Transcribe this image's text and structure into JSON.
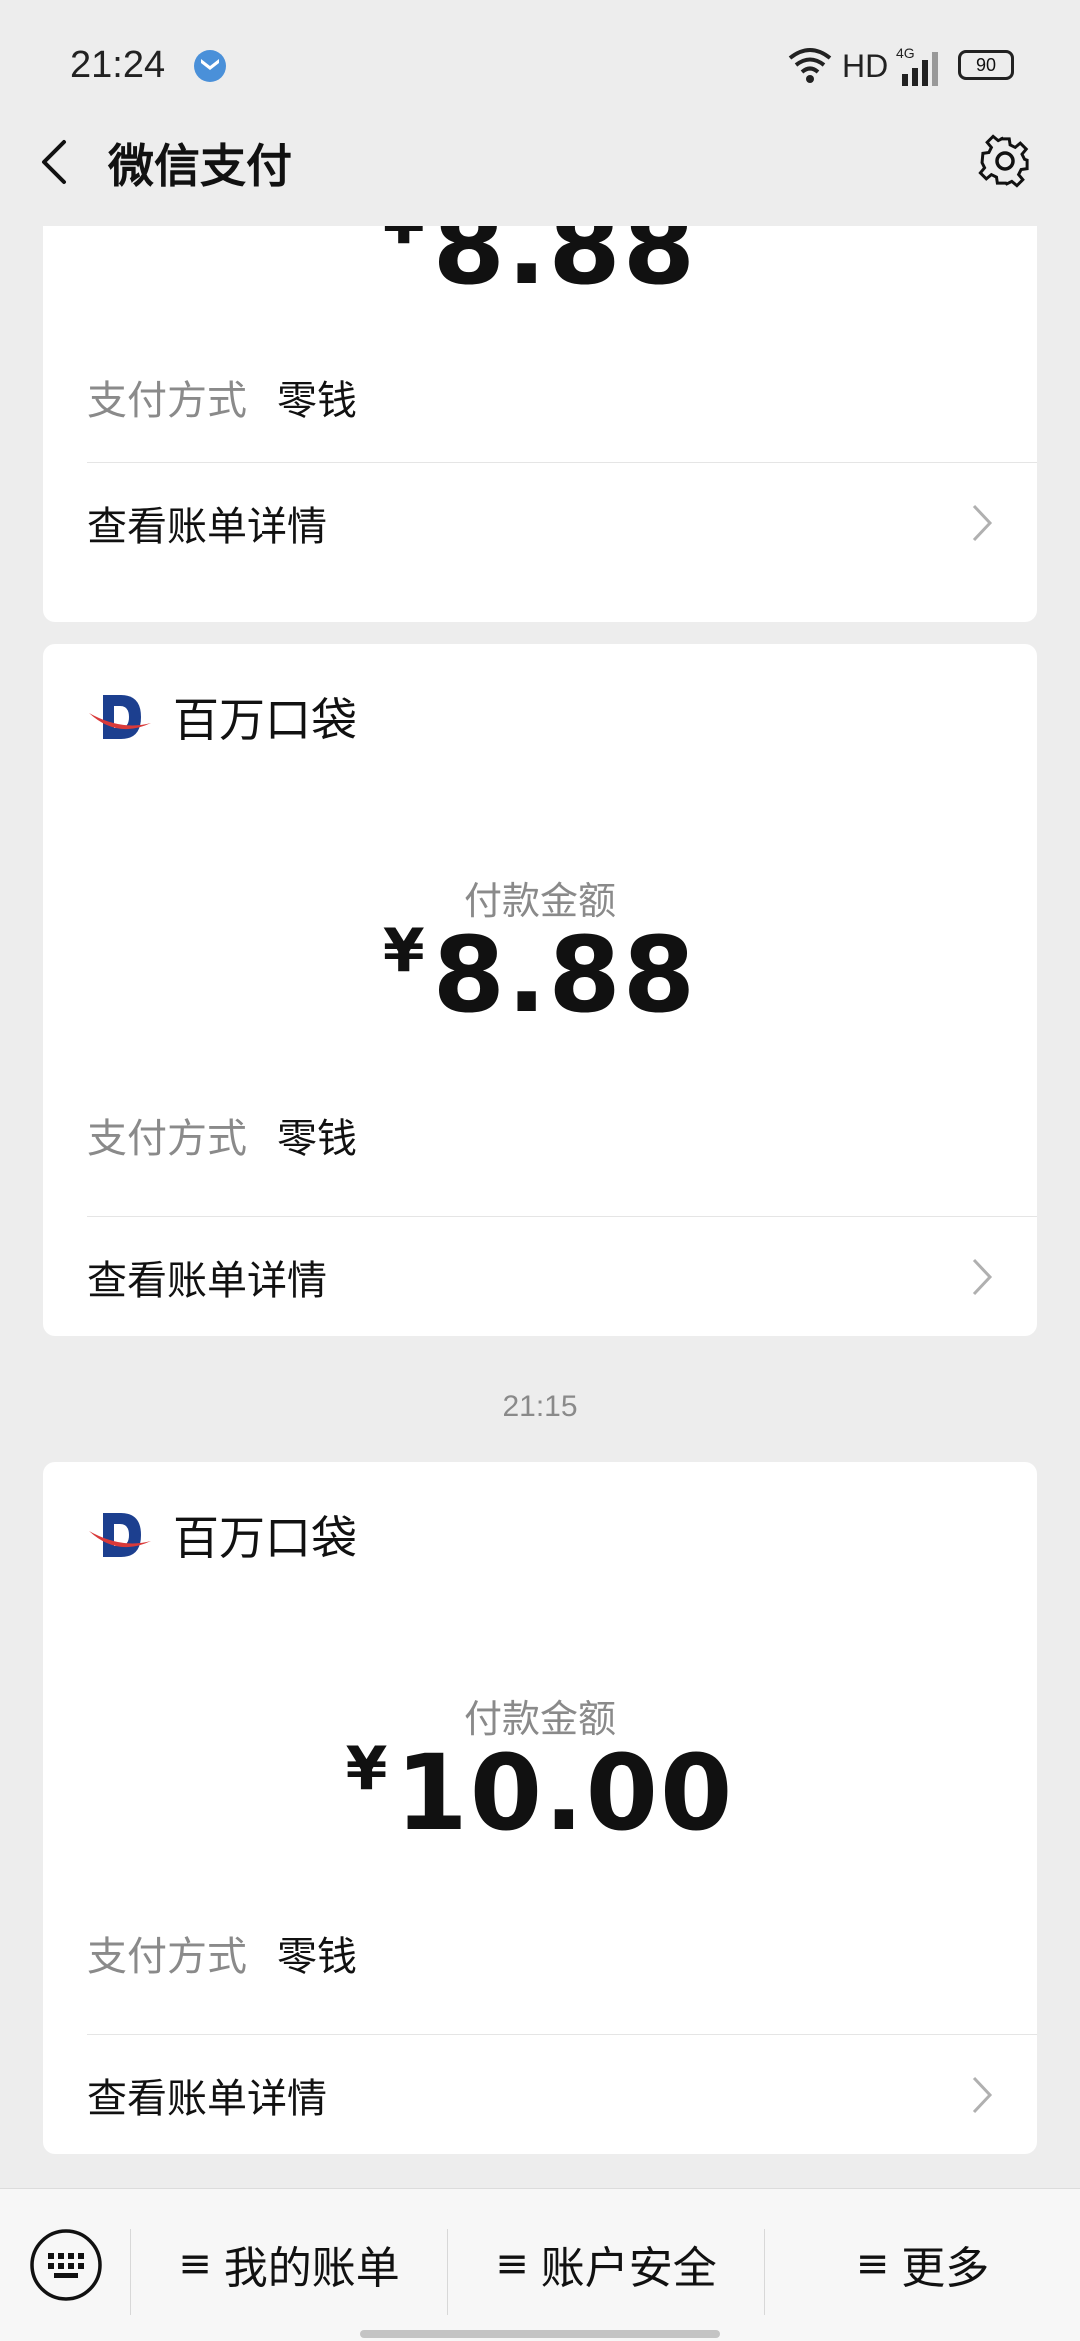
{
  "status_bar": {
    "time": "21:24",
    "network": "HD",
    "signal_label": "4G",
    "battery": "90"
  },
  "nav": {
    "title": "微信支付"
  },
  "cards": [
    {
      "merchant": "",
      "amount_label": "",
      "currency": "¥",
      "amount": "8.88",
      "pay_method_label": "支付方式",
      "pay_method_value": "零钱",
      "detail_link": "查看账单详情"
    },
    {
      "merchant": "百万口袋",
      "amount_label": "付款金额",
      "currency": "¥",
      "amount": "8.88",
      "pay_method_label": "支付方式",
      "pay_method_value": "零钱",
      "detail_link": "查看账单详情"
    },
    {
      "merchant": "百万口袋",
      "amount_label": "付款金额",
      "currency": "¥",
      "amount": "10.00",
      "pay_method_label": "支付方式",
      "pay_method_value": "零钱",
      "detail_link": "查看账单详情"
    }
  ],
  "timestamp": "21:15",
  "bottom_menu": {
    "my_bills": "我的账单",
    "account_security": "账户安全",
    "more": "更多",
    "hamburger": "≡"
  },
  "colors": {
    "background": "#ededed",
    "card": "#ffffff",
    "secondary_text": "#8a8a8a",
    "logo_blue": "#1c3f8f",
    "logo_red": "#d93a3a"
  },
  "icons": [
    "notification-icon",
    "wifi-icon",
    "signal-icon",
    "battery-icon",
    "back-icon",
    "gear-icon",
    "merchant-logo",
    "chevron-right-icon",
    "keyboard-icon"
  ]
}
